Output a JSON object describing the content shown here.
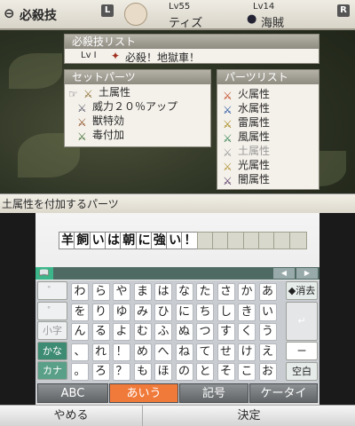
{
  "header": {
    "l_key": "L",
    "r_key": "R",
    "title": "必殺技",
    "player": {
      "level": "Lv55",
      "name": "ティズ"
    },
    "enemy": {
      "level": "Lv14",
      "name": "海賊"
    }
  },
  "skill_list": {
    "title": "必殺技リスト",
    "level": "Lv Ⅰ",
    "name": "必殺！地獄車！"
  },
  "set_parts": {
    "title": "セットパーツ",
    "items": [
      "土属性",
      "威力２０％アップ",
      "獣特効",
      "毒付加"
    ]
  },
  "parts_list": {
    "title": "パーツリスト",
    "items": [
      "火属性",
      "水属性",
      "雷属性",
      "風属性",
      "土属性",
      "光属性",
      "闇属性"
    ]
  },
  "hint": "土属性を付加するパーツ",
  "input": {
    "chars": [
      "羊",
      "飼",
      "い",
      "は",
      "朝",
      "に",
      "強",
      "い",
      "！",
      "",
      "",
      "",
      "",
      "",
      "",
      ""
    ]
  },
  "keyboard": {
    "dictionary_tab": "📖",
    "rows": [
      [
        "わ",
        "ら",
        "や",
        "ま",
        "は",
        "な",
        "た",
        "さ",
        "か",
        "あ"
      ],
      [
        "を",
        "り",
        "ゆ",
        "み",
        "ひ",
        "に",
        "ち",
        "し",
        "き",
        "い"
      ],
      [
        "ん",
        "る",
        "よ",
        "む",
        "ふ",
        "ぬ",
        "つ",
        "す",
        "く",
        "う"
      ],
      [
        "、",
        "れ",
        "！",
        "め",
        "へ",
        "ね",
        "て",
        "せ",
        "け",
        "え"
      ],
      [
        "。",
        "ろ",
        "？",
        "も",
        "ほ",
        "の",
        "と",
        "そ",
        "こ",
        "お"
      ]
    ],
    "left_keys": [
      "゛",
      "゜",
      "小字",
      "かな",
      "カナ"
    ],
    "delete": "◆消去",
    "enter": "↵",
    "long_vowel": "ー",
    "space": "空白",
    "modes": [
      "ABC",
      "あいう",
      "記号",
      "ケータイ"
    ],
    "cancel": "やめる",
    "confirm": "決定"
  },
  "colors": {
    "active_mode": "#f07a3a",
    "kana_key": "#5aa088"
  }
}
